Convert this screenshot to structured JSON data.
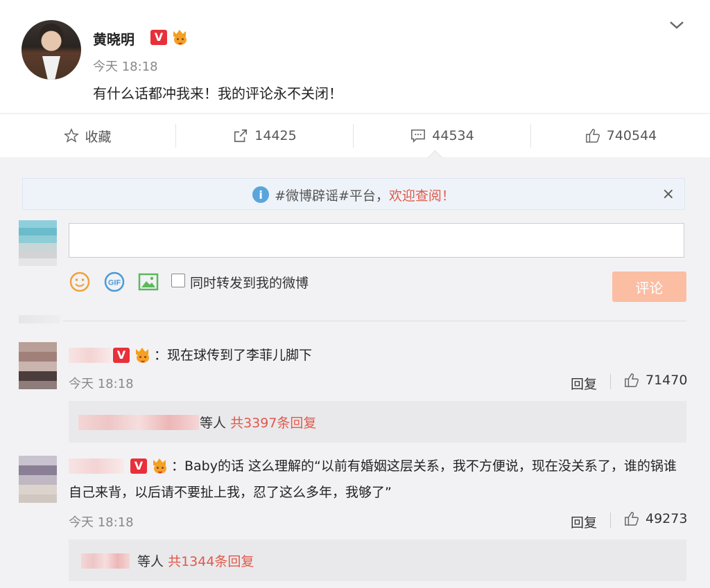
{
  "post": {
    "author": "黄晓明",
    "verified_badge": "V",
    "time": "今天 18:18",
    "text": "有什么话都冲我来！我的评论永不关闭！"
  },
  "actions": {
    "favorite": "收藏",
    "repost_count": "14425",
    "comment_count": "44534",
    "like_count": "740544"
  },
  "notice": {
    "text": "#微博辟谣#平台，",
    "highlight": "欢迎查阅！",
    "close": "×"
  },
  "composer": {
    "repost_label": "同时转发到我的微博",
    "submit_label": "评论"
  },
  "comments": [
    {
      "badge": "V",
      "text": "：现在球传到了李菲儿脚下",
      "time": "今天 18:18",
      "reply_label": "回复",
      "likes": "71470",
      "replies_suffix": "等人",
      "replies_count": "共3397条回复"
    },
    {
      "badge": "V",
      "text": "：Baby的话 这么理解的“以前有婚姻这层关系，我不方便说，现在没关系了，谁的锅谁自己来背，以后请不要扯上我，忍了这么多年，我够了”",
      "time": "今天 18:18",
      "reply_label": "回复",
      "likes": "49273",
      "replies_suffix": "等人",
      "replies_count": "共1344条回复"
    }
  ],
  "colors": {
    "accent_red": "#e0594a",
    "verified_red": "#e8303a",
    "submit_disabled": "#fbbea3",
    "notice_bg": "#eef3f9"
  },
  "icons": [
    "chevron-down-icon",
    "star-icon",
    "repost-icon",
    "comment-icon",
    "thumbs-up-icon",
    "info-icon",
    "close-icon",
    "emoji-icon",
    "gif-icon",
    "image-icon"
  ]
}
